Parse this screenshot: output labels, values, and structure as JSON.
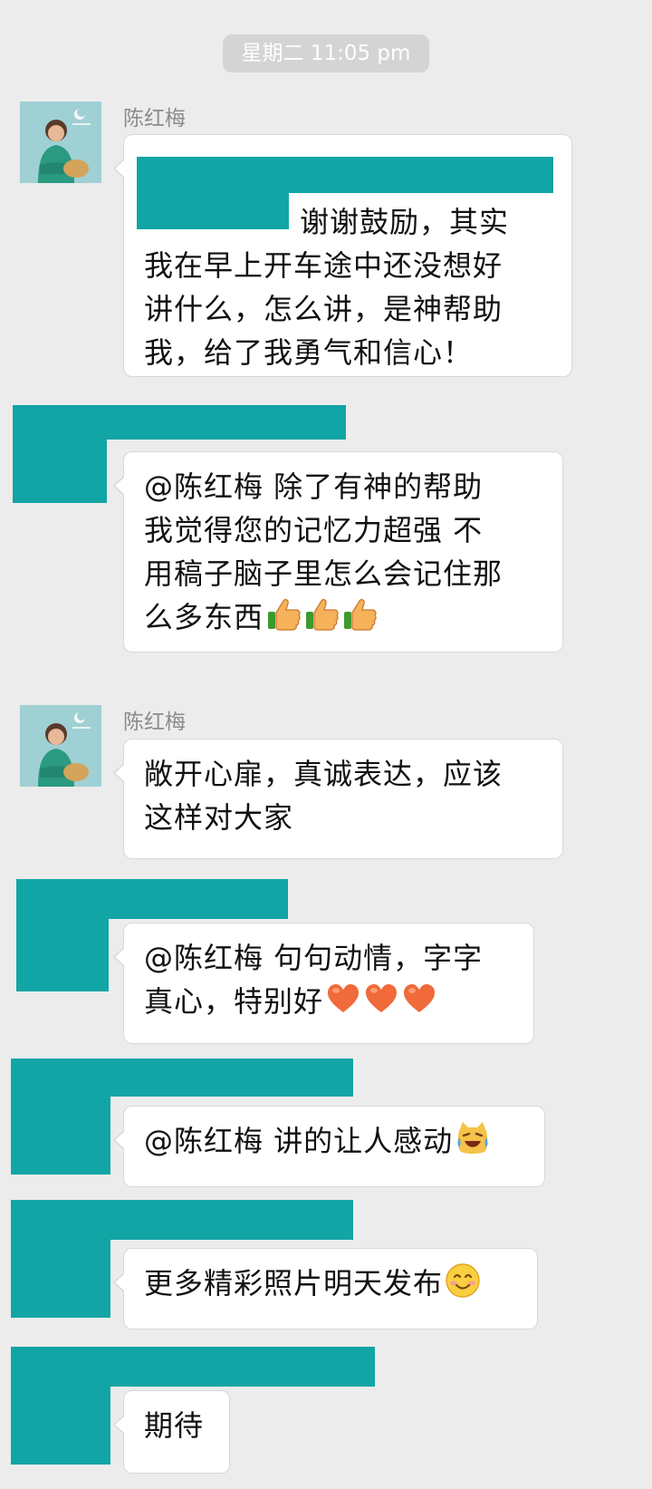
{
  "timestamp": "星期二 11:05 pm",
  "messages": [
    {
      "sender": "陈红梅",
      "lines": [
        "谢谢鼓励，其实",
        "我在早上开车途中还没想好",
        "讲什么，怎么讲，是神帮助",
        "我，给了我勇气和信心！"
      ]
    },
    {
      "sender": "",
      "lines": [
        "@陈红梅 除了有神的帮助",
        "我觉得您的记忆力超强 不",
        "用稿子脑子里怎么会记住那",
        "么多东西"
      ],
      "emoji": [
        "thumbs-up-icon",
        "thumbs-up-icon",
        "thumbs-up-icon"
      ]
    },
    {
      "sender": "陈红梅",
      "lines": [
        "敞开心扉，真诚表达，应该",
        "这样对大家"
      ]
    },
    {
      "sender": "",
      "lines": [
        "@陈红梅 句句动情，字字",
        "真心，特别好"
      ],
      "emoji": [
        "heart-icon",
        "heart-icon",
        "heart-icon"
      ]
    },
    {
      "sender": "",
      "lines": [
        "@陈红梅 讲的让人感动"
      ],
      "emoji": [
        "tears-of-joy-cat-icon"
      ]
    },
    {
      "sender": "",
      "lines": [
        "更多精彩照片明天发布"
      ],
      "emoji": [
        "smiling-face-icon"
      ]
    },
    {
      "sender": "",
      "lines": [
        "期待"
      ]
    }
  ],
  "colors": {
    "background": "#ececec",
    "redaction": "#12a5a5",
    "bubble": "#ffffff",
    "sender_text": "#8c8c8c"
  }
}
